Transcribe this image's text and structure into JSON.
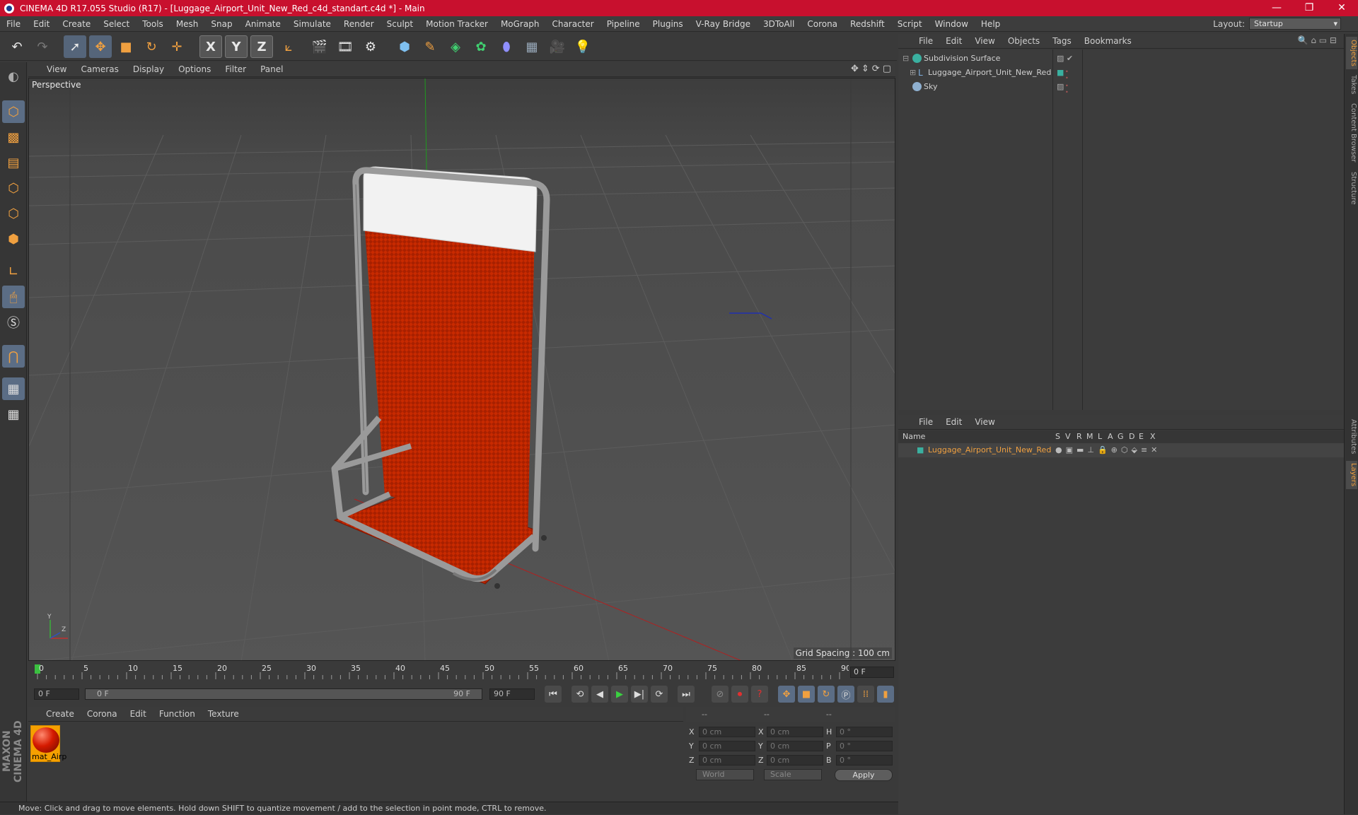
{
  "window": {
    "title": "CINEMA 4D R17.055 Studio (R17) - [Luggage_Airport_Unit_New_Red_c4d_standart.c4d *] - Main",
    "min": "—",
    "max": "❐",
    "close": "✕"
  },
  "menu": [
    "File",
    "Edit",
    "Create",
    "Select",
    "Tools",
    "Mesh",
    "Snap",
    "Animate",
    "Simulate",
    "Render",
    "Sculpt",
    "Motion Tracker",
    "MoGraph",
    "Character",
    "Pipeline",
    "Plugins",
    "V-Ray Bridge",
    "3DToAll",
    "Corona",
    "Redshift",
    "Script",
    "Window",
    "Help"
  ],
  "layout": {
    "label": "Layout:",
    "value": "Startup"
  },
  "toolbar": {
    "undo": "↶",
    "redo": "↷",
    "select": "➚",
    "move": "✥",
    "scale": "■",
    "rotate": "↻",
    "transform": "✛",
    "x": "X",
    "y": "Y",
    "z": "Z",
    "coord": "⟀",
    "render_view": "🎬",
    "render_pic": "🎞",
    "render_settings": "⚙",
    "cube": "⬢",
    "pen": "✎",
    "subdiv": "◈",
    "array": "✿",
    "deform": "⬮",
    "floor": "▦",
    "camera": "🎥",
    "light": "💡"
  },
  "viewport": {
    "menu": [
      "View",
      "Cameras",
      "Display",
      "Options",
      "Filter",
      "Panel"
    ],
    "label": "Perspective",
    "grid_spacing": "Grid Spacing : 100 cm",
    "nav": [
      "✥",
      "⇕",
      "⟳",
      "▢"
    ]
  },
  "timeline": {
    "ticks": [
      "0",
      "5",
      "10",
      "15",
      "20",
      "25",
      "30",
      "35",
      "40",
      "45",
      "50",
      "55",
      "60",
      "65",
      "70",
      "75",
      "80",
      "85",
      "90"
    ],
    "current": "0 F",
    "start": "0 F",
    "range_start": "0 F",
    "range_end": "90 F",
    "end": "90 F"
  },
  "transport": [
    "⏮",
    "⟲",
    "◀",
    "▶",
    "▶|",
    "⟳",
    "⏭"
  ],
  "material_manager": {
    "menu": [
      "Create",
      "Corona",
      "Edit",
      "Function",
      "Texture"
    ],
    "material_name": "mat_Airp"
  },
  "coordinates": {
    "headers": [
      "--",
      "--",
      "--"
    ],
    "rows": [
      {
        "a": "X",
        "av": "0 cm",
        "b": "X",
        "bv": "0 cm",
        "c": "H",
        "cv": "0 °"
      },
      {
        "a": "Y",
        "av": "0 cm",
        "b": "Y",
        "bv": "0 cm",
        "c": "P",
        "cv": "0 °"
      },
      {
        "a": "Z",
        "av": "0 cm",
        "b": "Z",
        "bv": "0 cm",
        "c": "B",
        "cv": "0 °"
      }
    ],
    "world": "World",
    "scale": "Scale",
    "apply": "Apply"
  },
  "status": "Move: Click and drag to move elements. Hold down SHIFT to quantize movement / add to the selection in point mode, CTRL to remove.",
  "maxon": "MAXON CINEMA 4D",
  "objects": {
    "menu": [
      "File",
      "Edit",
      "View",
      "Objects",
      "Tags",
      "Bookmarks"
    ],
    "items": [
      {
        "name": "Subdivision Surface",
        "color": "#3ab0a0"
      },
      {
        "name": "Luggage_Airport_Unit_New_Red",
        "color": "#7fb0e0"
      },
      {
        "name": "Sky",
        "color": "#8fb0d0"
      }
    ]
  },
  "layers": {
    "menu": [
      "File",
      "Edit",
      "View"
    ],
    "headers": [
      "Name",
      "S",
      "V",
      "R",
      "M",
      "L",
      "A",
      "G",
      "D",
      "E",
      "X"
    ],
    "items": [
      {
        "name": "Luggage_Airport_Unit_New_Red",
        "color": "#f0a040"
      }
    ]
  },
  "right_tabs": [
    "Objects",
    "Takes",
    "Content Browser",
    "Structure",
    "Attributes",
    "Layers"
  ]
}
